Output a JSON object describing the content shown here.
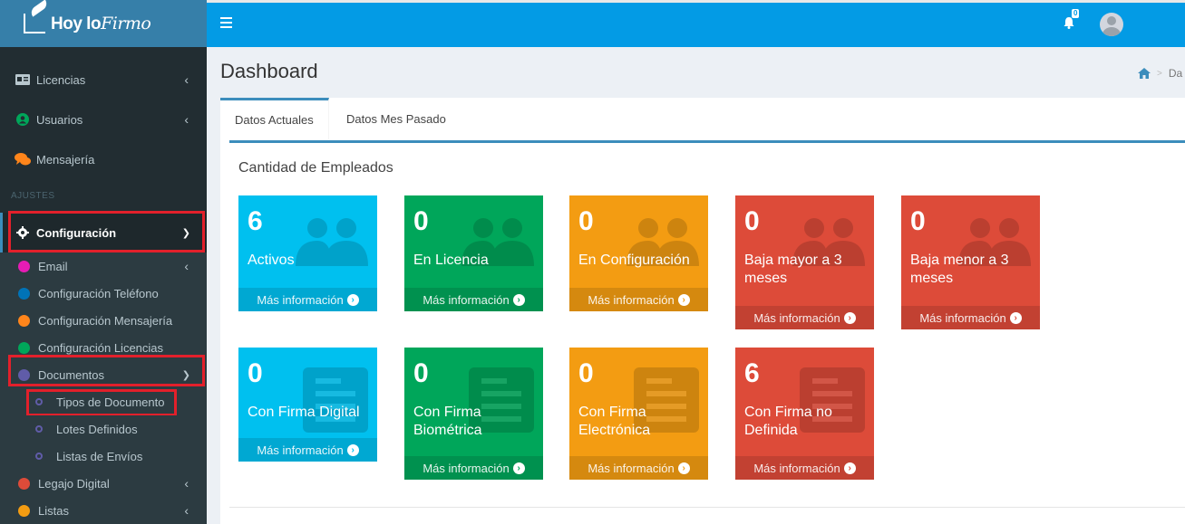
{
  "brand": {
    "name_bold": "Hoy lo",
    "name_script": "Firmo"
  },
  "sidebar": {
    "items_top": [
      {
        "label": "Licencias"
      },
      {
        "label": "Usuarios"
      },
      {
        "label": "Mensajería"
      }
    ],
    "section_header": "AJUSTES",
    "config": {
      "label": "Configuración"
    },
    "submenu": [
      {
        "label": "Email",
        "color": "#e61cb5"
      },
      {
        "label": "Configuración Teléfono",
        "color": "#0073b7"
      },
      {
        "label": "Configuración Mensajería",
        "color": "#ff851b"
      },
      {
        "label": "Configuración Licencias",
        "color": "#00a65a"
      },
      {
        "label": "Documentos",
        "color": "#605ca8"
      }
    ],
    "documentos_children": [
      {
        "label": "Tipos de Documento"
      },
      {
        "label": "Lotes Definidos"
      },
      {
        "label": "Listas de Envíos"
      }
    ],
    "bottom": [
      {
        "label": "Legajo Digital",
        "color": "#dd4b39"
      },
      {
        "label": "Listas",
        "color": "#f39c12"
      }
    ]
  },
  "header": {
    "notifications_count": "0"
  },
  "page": {
    "title": "Dashboard",
    "breadcrumb": "Da"
  },
  "tabs": [
    {
      "label": "Datos Actuales"
    },
    {
      "label": "Datos Mes Pasado"
    }
  ],
  "section": {
    "title": "Cantidad de Empleados"
  },
  "more_info": "Más información",
  "cards_row1": [
    {
      "value": "6",
      "label": "Activos",
      "color": "#00c0ef"
    },
    {
      "value": "0",
      "label": "En Licencia",
      "color": "#00a65a"
    },
    {
      "value": "0",
      "label": "En Configuración",
      "color": "#f39c12"
    },
    {
      "value": "0",
      "label": "Baja mayor a 3 meses",
      "color": "#dd4b39"
    },
    {
      "value": "0",
      "label": "Baja menor a 3 meses",
      "color": "#dd4b39"
    }
  ],
  "cards_row2": [
    {
      "value": "0",
      "label": "Con Firma Digital",
      "color": "#00c0ef"
    },
    {
      "value": "0",
      "label": "Con Firma Biométrica",
      "color": "#00a65a"
    },
    {
      "value": "0",
      "label": "Con Firma Electrónica",
      "color": "#f39c12"
    },
    {
      "value": "6",
      "label": "Con Firma no Definida",
      "color": "#dd4b39"
    }
  ]
}
